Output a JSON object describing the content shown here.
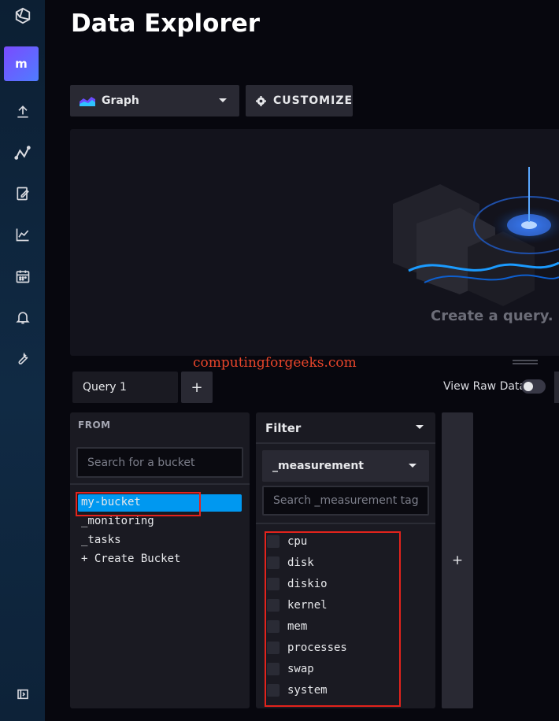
{
  "page": {
    "title": "Data Explorer"
  },
  "nav": {
    "org_initial": "m",
    "items": [
      {
        "icon": "influx-logo-icon"
      },
      {
        "icon": "upload-icon"
      },
      {
        "icon": "data-explorer-icon"
      },
      {
        "icon": "notebook-icon"
      },
      {
        "icon": "dashboard-icon"
      },
      {
        "icon": "tasks-calendar-icon"
      },
      {
        "icon": "alerts-bell-icon"
      },
      {
        "icon": "settings-wrench-icon"
      },
      {
        "icon": "collapse-sidebar-icon"
      }
    ]
  },
  "toolbar": {
    "view_type": "Graph",
    "customize_label": "CUSTOMIZE"
  },
  "graph": {
    "empty_text": "Create a query. H"
  },
  "watermark": "computingforgeeks.com",
  "query": {
    "tab_label": "Query 1",
    "add_label": "+",
    "view_raw_label": "View Raw Data",
    "view_raw_on": false
  },
  "from": {
    "label": "FROM",
    "search_placeholder": "Search for a bucket",
    "buckets": [
      "my-bucket",
      "_monitoring",
      "_tasks"
    ],
    "selected": "my-bucket",
    "create_label": "+ Create Bucket"
  },
  "filter": {
    "label": "Filter",
    "key": "_measurement",
    "search_placeholder": "Search _measurement tag",
    "values": [
      "cpu",
      "disk",
      "diskio",
      "kernel",
      "mem",
      "processes",
      "swap",
      "system"
    ]
  },
  "add_filter_label": "+",
  "colors": {
    "accent": "#0098f0",
    "highlight_box": "#e3231c",
    "watermark": "#e8452a"
  }
}
